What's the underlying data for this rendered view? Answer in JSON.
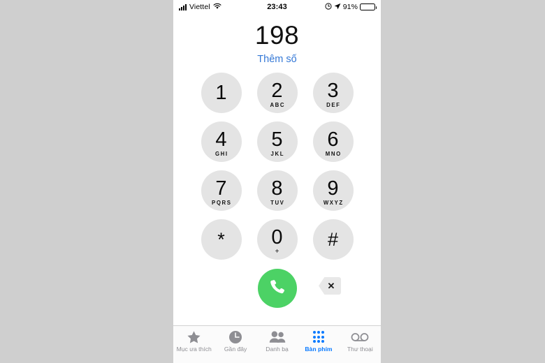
{
  "status_bar": {
    "carrier": "Viettel",
    "wifi_icon": "wifi-icon",
    "signal_icon": "signal-bars-icon",
    "time": "23:43",
    "alarm_icon": "alarm-clock-icon",
    "location_icon": "location-arrow-icon",
    "battery_percent": "91%",
    "battery_icon": "battery-full-icon"
  },
  "display": {
    "number": "198",
    "add_number_label": "Thêm số",
    "add_number_color": "#3478d6"
  },
  "keypad": {
    "rows": [
      [
        {
          "digit": "1",
          "letters": ""
        },
        {
          "digit": "2",
          "letters": "ABC"
        },
        {
          "digit": "3",
          "letters": "DEF"
        }
      ],
      [
        {
          "digit": "4",
          "letters": "GHI"
        },
        {
          "digit": "5",
          "letters": "JKL"
        },
        {
          "digit": "6",
          "letters": "MNO"
        }
      ],
      [
        {
          "digit": "7",
          "letters": "PQRS"
        },
        {
          "digit": "8",
          "letters": "TUV"
        },
        {
          "digit": "9",
          "letters": "WXYZ"
        }
      ],
      [
        {
          "digit": "*",
          "letters": ""
        },
        {
          "digit": "0",
          "letters": "+"
        },
        {
          "digit": "#",
          "letters": ""
        }
      ]
    ],
    "key_background": "#e4e4e4"
  },
  "actions": {
    "call_icon": "phone-handset-icon",
    "call_color": "#4cd265",
    "delete_icon": "backspace-delete-icon",
    "delete_glyph": "✕"
  },
  "tab_bar": {
    "active_color": "#0a7aff",
    "inactive_color": "#8e8e93",
    "tabs": [
      {
        "label": "Mục ưa thích",
        "icon": "star-icon",
        "active": false
      },
      {
        "label": "Gần đây",
        "icon": "clock-icon",
        "active": false
      },
      {
        "label": "Danh bạ",
        "icon": "contacts-people-icon",
        "active": false
      },
      {
        "label": "Bàn phím",
        "icon": "keypad-dots-icon",
        "active": true
      },
      {
        "label": "Thư thoại",
        "icon": "voicemail-icon",
        "active": false
      }
    ]
  },
  "page_background": "#cfcfcf"
}
